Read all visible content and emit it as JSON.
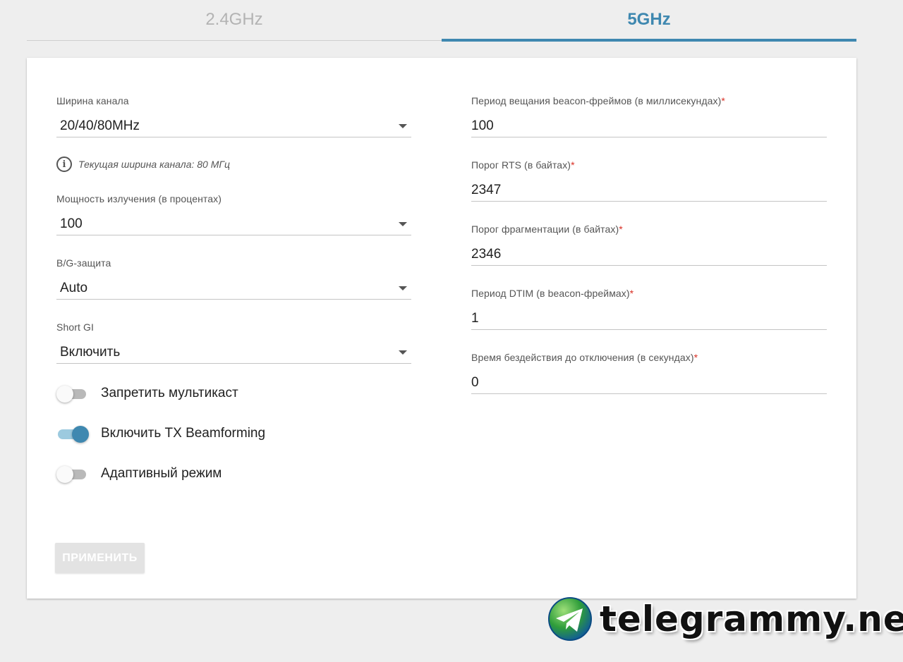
{
  "tabs": [
    {
      "label": "2.4GHz",
      "active": false
    },
    {
      "label": "5GHz",
      "active": true
    }
  ],
  "left": {
    "channel_width": {
      "label": "Ширина канала",
      "value": "20/40/80MHz"
    },
    "current_width_hint": "Текущая ширина канала: 80 МГц",
    "tx_power": {
      "label": "Мощность излучения (в процентах)",
      "value": "100"
    },
    "bg_protection": {
      "label": "B/G-защита",
      "value": "Auto"
    },
    "short_gi": {
      "label": "Short GI",
      "value": "Включить"
    },
    "toggles": [
      {
        "label": "Запретить мультикаст",
        "on": false
      },
      {
        "label": "Включить TX Beamforming",
        "on": true
      },
      {
        "label": "Адаптивный режим",
        "on": false
      }
    ]
  },
  "right": {
    "beacon_period": {
      "label": "Период вещания beacon-фреймов (в миллисекундах)",
      "required": "*",
      "value": "100"
    },
    "rts_threshold": {
      "label": "Порог RTS (в байтах)",
      "required": "*",
      "value": "2347"
    },
    "frag_threshold": {
      "label": "Порог фрагментации (в байтах)",
      "required": "*",
      "value": "2346"
    },
    "dtim_period": {
      "label": "Период DTIM (в beacon-фреймах)",
      "required": "*",
      "value": "1"
    },
    "idle_timeout": {
      "label": "Время бездействия до отключения (в секундах)",
      "required": "*",
      "value": "0"
    }
  },
  "apply_button": "ПРИМЕНИТЬ",
  "watermark": "telegrammy.net",
  "colors": {
    "accent": "#3f88b0",
    "required": "#d93025",
    "background": "#eeeeee"
  }
}
